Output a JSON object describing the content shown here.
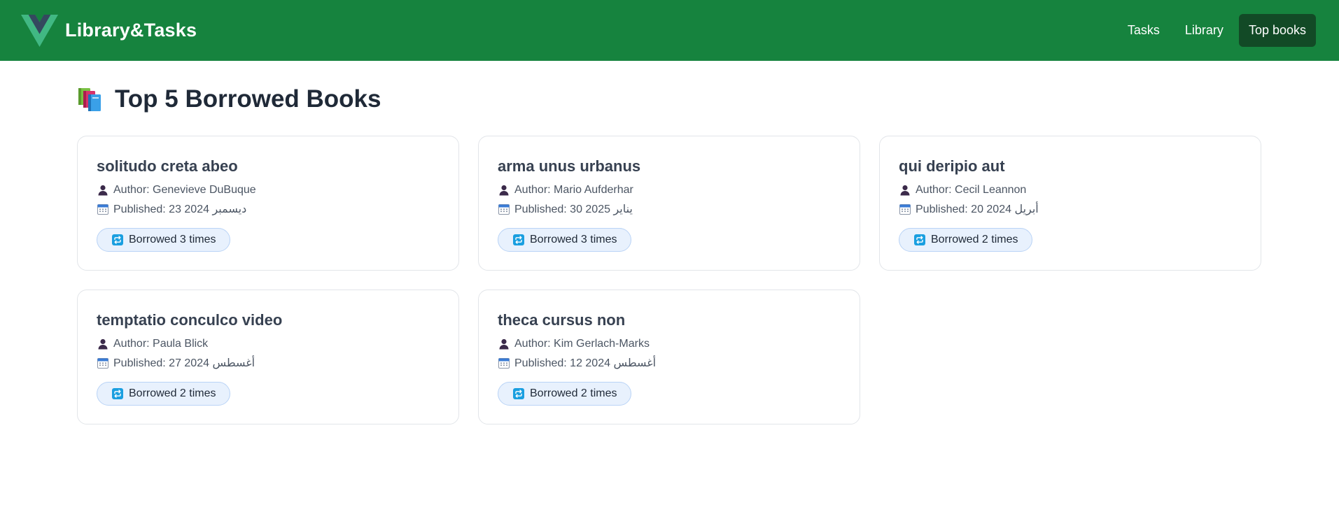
{
  "header": {
    "brand": "Library&Tasks",
    "nav": [
      {
        "label": "Tasks"
      },
      {
        "label": "Library"
      },
      {
        "label": "Top books"
      }
    ]
  },
  "page": {
    "title": "Top 5 Borrowed Books"
  },
  "books": [
    {
      "title": "solitudo creta abeo",
      "author": "Author: Genevieve DuBuque",
      "published": "Published: 23 ديسمبر 2024",
      "borrowed": "Borrowed 3 times"
    },
    {
      "title": "arma unus urbanus",
      "author": "Author: Mario Aufderhar",
      "published": "Published: 30 يناير 2025",
      "borrowed": "Borrowed 3 times"
    },
    {
      "title": "qui deripio aut",
      "author": "Author: Cecil Leannon",
      "published": "Published: 20 أبريل 2024",
      "borrowed": "Borrowed 2 times"
    },
    {
      "title": "temptatio conculco video",
      "author": "Author: Paula Blick",
      "published": "Published: 27 أغسطس 2024",
      "borrowed": "Borrowed 2 times"
    },
    {
      "title": "theca cursus non",
      "author": "Author: Kim Gerlach-Marks",
      "published": "Published: 12 أغسطس 2024",
      "borrowed": "Borrowed 2 times"
    }
  ],
  "icons": {
    "logo": "vue-logo-icon",
    "heading": "books-icon",
    "author": "person-icon",
    "published": "calendar-icon",
    "borrowed": "repeat-icon"
  },
  "colors": {
    "header_bg": "#16833e",
    "active_nav_bg": "#124a26",
    "badge_bg": "#e8f1fd",
    "badge_border": "#b9d3f6"
  }
}
